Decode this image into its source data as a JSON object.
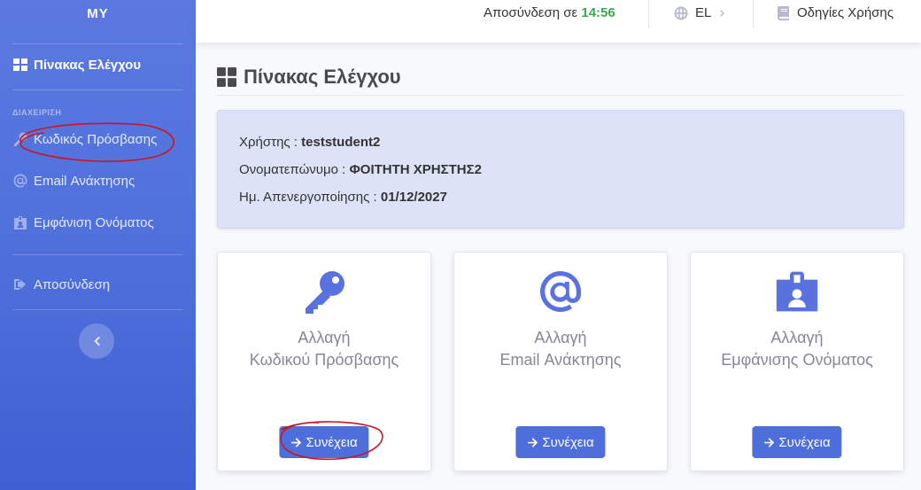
{
  "sidebar": {
    "brand": "MY",
    "dashboard_label": "Πίνακας Ελέγχου",
    "heading": "ΔΙΑΧΕΙΡΙΣΗ",
    "items": [
      {
        "label": "Κωδικός Πρόσβασης",
        "icon": "key-icon"
      },
      {
        "label": "Email Ανάκτησης",
        "icon": "at-icon"
      },
      {
        "label": "Εμφάνιση Ονόματος",
        "icon": "id-badge-icon"
      }
    ],
    "logout_label": "Αποσύνδεση"
  },
  "topbar": {
    "logout_text": "Αποσύνδεση σε",
    "logout_time": "14:56",
    "language": "EL",
    "guide_label": "Οδηγίες Χρήσης"
  },
  "main": {
    "title": "Πίνακας Ελέγχου",
    "info": {
      "user_label": "Χρήστης :",
      "user_value": "teststudent2",
      "name_label": "Ονοματεπώνυμο :",
      "name_value": "ΦΟΙΤΗΤΗ ΧΡΗΣΤΗΣ2",
      "expiry_label": "Ημ. Απενεργοποίησης :",
      "expiry_value": "01/12/2027"
    },
    "cards": [
      {
        "line1": "Αλλαγή",
        "line2": "Κωδικού Πρόσβασης",
        "button": "Συνέχεια",
        "icon": "key-icon"
      },
      {
        "line1": "Αλλαγή",
        "line2": "Email Ανάκτησης",
        "button": "Συνέχεια",
        "icon": "at-icon"
      },
      {
        "line1": "Αλλαγή",
        "line2": "Εμφάνισης Ονόματος",
        "button": "Συνέχεια",
        "icon": "id-badge-icon"
      }
    ]
  },
  "colors": {
    "sidebar": "#4e6fdb",
    "accent": "#4e6fdb",
    "timer": "#3aa853",
    "annotation": "#d0131b"
  }
}
